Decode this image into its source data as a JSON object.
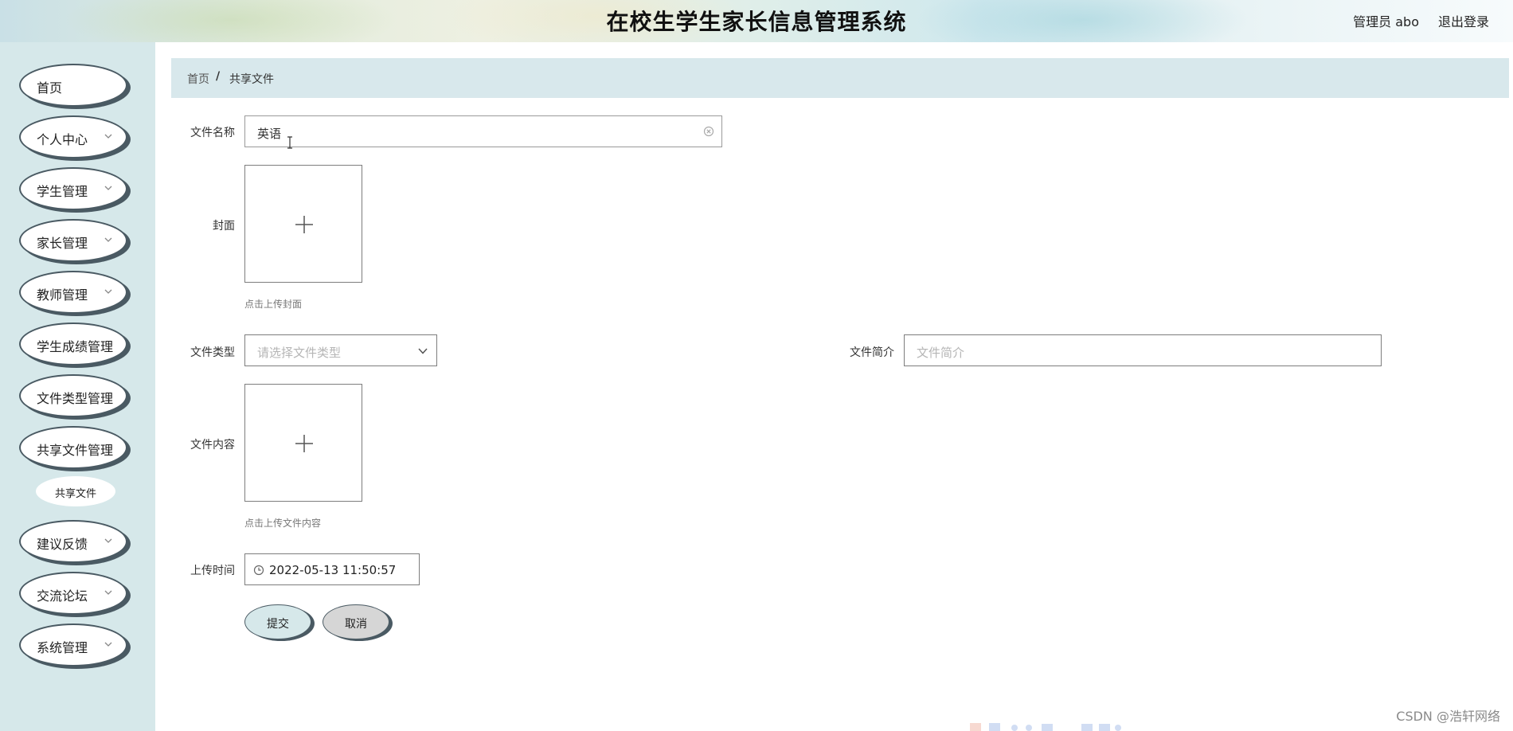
{
  "header": {
    "title": "在校生学生家长信息管理系统",
    "user": "管理员 abo",
    "logout": "退出登录"
  },
  "sidebar": {
    "items": [
      {
        "label": "首页",
        "has_submenu": false
      },
      {
        "label": "个人中心",
        "has_submenu": true
      },
      {
        "label": "学生管理",
        "has_submenu": true
      },
      {
        "label": "家长管理",
        "has_submenu": true
      },
      {
        "label": "教师管理",
        "has_submenu": true
      },
      {
        "label": "学生成绩管理",
        "has_submenu": true
      },
      {
        "label": "文件类型管理",
        "has_submenu": true
      },
      {
        "label": "共享文件管理",
        "has_submenu": true,
        "expanded": true
      },
      {
        "label": "建议反馈",
        "has_submenu": true
      },
      {
        "label": "交流论坛",
        "has_submenu": true
      },
      {
        "label": "系统管理",
        "has_submenu": true
      }
    ],
    "subitems": [
      {
        "label": "共享文件"
      }
    ]
  },
  "breadcrumb": {
    "home": "首页",
    "separator": "/",
    "current": "共享文件"
  },
  "form": {
    "file_name": {
      "label": "文件名称",
      "value": "英语"
    },
    "cover": {
      "label": "封面",
      "hint": "点击上传封面"
    },
    "file_type": {
      "label": "文件类型",
      "placeholder": "请选择文件类型"
    },
    "file_intro": {
      "label": "文件简介",
      "placeholder": "文件简介"
    },
    "file_content": {
      "label": "文件内容",
      "hint": "点击上传文件内容"
    },
    "upload_time": {
      "label": "上传时间",
      "value": "2022-05-13 11:50:57"
    },
    "submit_label": "提交",
    "cancel_label": "取消"
  },
  "watermark": "CSDN @浩轩网络",
  "colors": {
    "sidebar_bg": "#d6e8ea",
    "breadcrumb_bg": "#d8e8ec",
    "pill_border": "#4a5a63",
    "submit_bg": "#d6e8ea",
    "cancel_bg": "#d6d6d6"
  }
}
